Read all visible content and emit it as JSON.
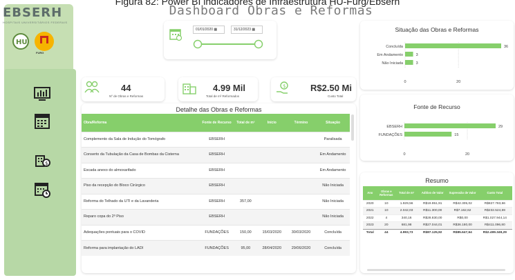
{
  "caption": "Figura 82: Power BI indicadores de Infraestrutura HU-Furg/Ebserh",
  "dashboard_title": "Dashboard Obras e Reformas",
  "sidebar": {
    "logo": "EBSERH",
    "logo_sub": "HOSPITAIS UNIVERSITÁRIOS FEDERAIS",
    "badge_furg_label": "FURG"
  },
  "filters": {
    "date_start": "01/01/2020",
    "date_end": "31/12/2023"
  },
  "kpis": [
    {
      "value": "44",
      "label": "Nº de Obras e Reformas"
    },
    {
      "value": "4.99 Mil",
      "label": "Total de m² Reformados"
    },
    {
      "value": "R$2.50 Mi",
      "label": "Custo Total"
    }
  ],
  "detail": {
    "title": "Detalhe das Obras e Reformas",
    "columns": [
      "Obra/Reforma",
      "Fonte de Recurso",
      "Total de m²",
      "Início",
      "Término",
      "Situação"
    ],
    "rows": [
      [
        "Complemento da Sala de Indução do Tomógrafo",
        "EBSERH",
        "",
        "",
        "",
        "Paralisada"
      ],
      [
        "Conserto da Tubulação da Casa de Bombas da Cisterna",
        "EBSERH",
        "",
        "",
        "",
        "Em Andamento"
      ],
      [
        "Escada anexo do almoxarifado",
        "EBSERH",
        "",
        "",
        "",
        "Em Andamento"
      ],
      [
        "Piso da recepção do Bloco Cirúrgico",
        "EBSERH",
        "",
        "",
        "",
        "Não Iniciada"
      ],
      [
        "Reforma do Telhado da UTI e da Lavanderia",
        "EBSERH",
        "357,00",
        "",
        "",
        "Não Iniciada"
      ],
      [
        "Reparo copa do 2º Piso",
        "EBSERH",
        "",
        "",
        "",
        "Não Iniciada"
      ],
      [
        "Adequações pontuais para o COVID",
        "FUNDAÇÕES",
        "150,00",
        "15/03/2020",
        "30/03/2020",
        "Concluída"
      ],
      [
        "Reforma para implantação do LADI",
        "FUNDAÇÕES",
        "95,00",
        "28/04/2020",
        "29/06/2020",
        "Concluída"
      ]
    ]
  },
  "situacao": {
    "title": "Situação das Obras e Reformas",
    "bar_color": "#86cf6b"
  },
  "fonte": {
    "title": "Fonte de Recurso",
    "bar_color": "#86cf6b"
  },
  "resumo": {
    "title": "Resumo",
    "columns": [
      "Ano",
      "Obras e Reformas",
      "Total de m²",
      "Aditivo de Valor",
      "Supressão de Valor",
      "Custo Total"
    ],
    "rows": [
      [
        "2020",
        "10",
        "1.929,56",
        "R$19.951,91",
        "R$42.305,02",
        "R$827.783,66"
      ],
      [
        "2021",
        "10",
        "2.042,03",
        "R$11.300,00",
        "R$7.162,62",
        "R$232.524,69"
      ],
      [
        "2022",
        "4",
        "340,16",
        "R$28.830,00",
        "R$0,00",
        "R$1.027.944,14"
      ],
      [
        "2023",
        "20",
        "681,98",
        "R$27.044,01",
        "R$36.180,00",
        "R$411.096,80"
      ]
    ],
    "total": [
      "Total",
      "44",
      "4.993,73",
      "R$87.125,92",
      "R$85.647,64",
      "R$2.499.349,29"
    ]
  },
  "chart_data": [
    {
      "type": "bar",
      "title": "Situação das Obras e Reformas",
      "categories": [
        "Concluída",
        "Em Andamento",
        "Não Iniciada"
      ],
      "values": [
        36,
        3,
        3
      ],
      "xticks": [
        "0",
        "20"
      ],
      "xlim": [
        0,
        36
      ]
    },
    {
      "type": "bar",
      "title": "Fonte de Recurso",
      "categories": [
        "EBSERH",
        "FUNDAÇÕES"
      ],
      "values": [
        29,
        15
      ],
      "xticks": [
        "0",
        "20"
      ],
      "xlim": [
        0,
        29
      ]
    }
  ]
}
